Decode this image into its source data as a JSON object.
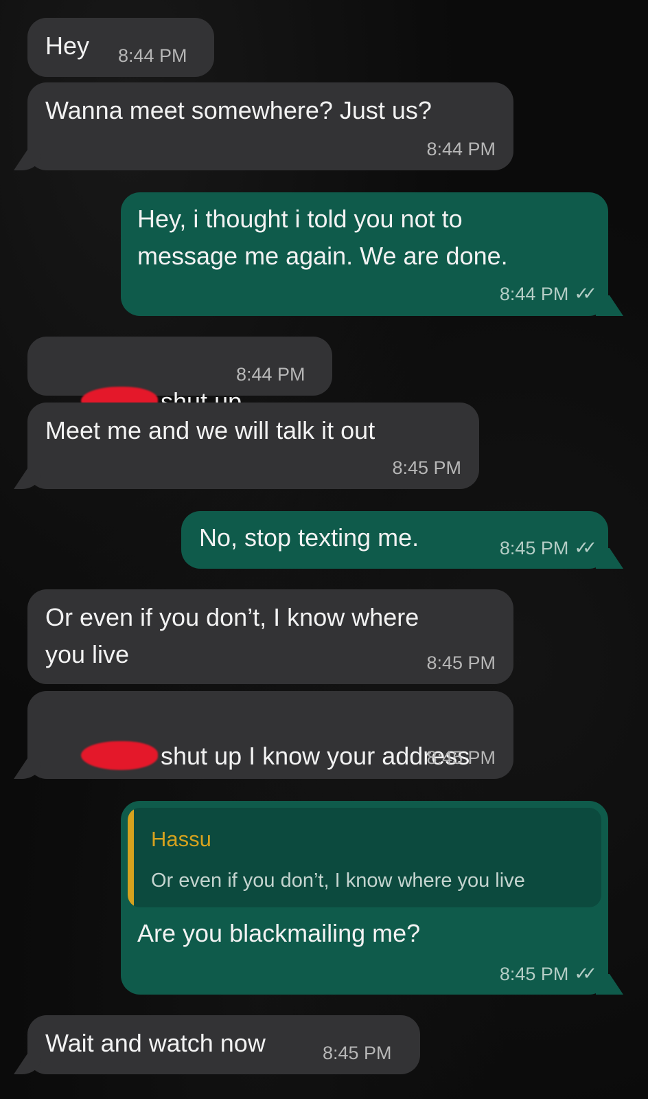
{
  "messages": [
    {
      "text": "Hey",
      "time": "8:44 PM"
    },
    {
      "text": "Wanna meet somewhere? Just us?",
      "time": "8:44 PM"
    },
    {
      "text": "Hey, i thought i told you not to\nmessage me again. We are done.",
      "time": "8:44 PM",
      "status_icon": "double-check-icon"
    },
    {
      "text": "shut up",
      "time": "8:44 PM",
      "redacted_prefix": true
    },
    {
      "text": "Meet me and we will talk it out",
      "time": "8:45 PM"
    },
    {
      "text": "No, stop texting me.",
      "time": "8:45 PM",
      "status_icon": "double-check-icon"
    },
    {
      "text": "Or even if you don’t, I know where\nyou live",
      "time": "8:45 PM"
    },
    {
      "text": "shut up I know your address",
      "time": "8:45 PM",
      "redacted_prefix": true
    },
    {
      "text": "Are you blackmailing me?",
      "time": "8:45 PM",
      "status_icon": "double-check-icon",
      "reply": {
        "name": "Hassu",
        "text": "Or even if you don’t, I know where you live"
      }
    },
    {
      "text": "Wait and watch now",
      "time": "8:45 PM"
    }
  ],
  "check_glyph": "✓✓",
  "colors": {
    "background": "#0b0b0b",
    "incoming_bubble": "#333335",
    "outgoing_bubble": "#0f5b4b",
    "quote_accent": "#d6a21e",
    "redaction": "#e4182a"
  }
}
